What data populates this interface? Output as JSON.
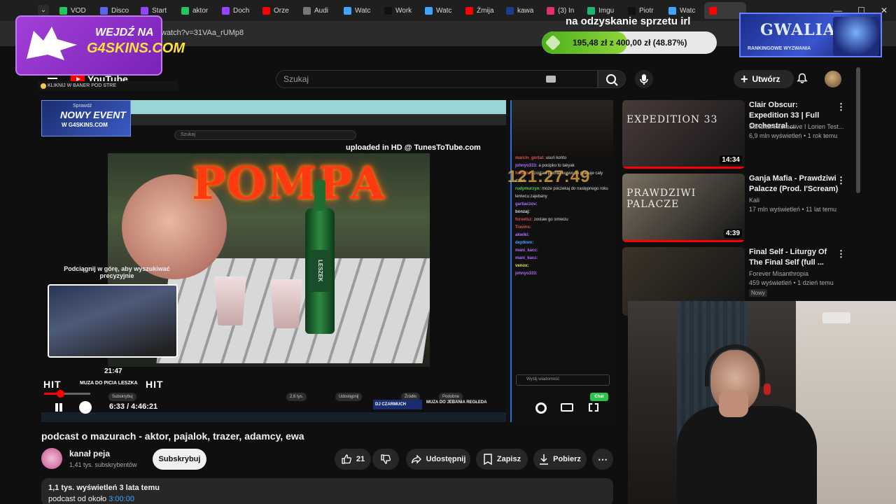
{
  "browser": {
    "tabs": [
      {
        "label": "VOD",
        "color": "#22c55e"
      },
      {
        "label": "Disco",
        "color": "#5865f2"
      },
      {
        "label": "Start",
        "color": "#9146ff"
      },
      {
        "label": "aktor",
        "color": "#22c55e"
      },
      {
        "label": "Doch",
        "color": "#9146ff"
      },
      {
        "label": "Orze",
        "color": "#ff0000"
      },
      {
        "label": "Audi",
        "color": "#777777"
      },
      {
        "label": "Watc",
        "color": "#3ea6ff"
      },
      {
        "label": "Work",
        "color": "#111111"
      },
      {
        "label": "Watc",
        "color": "#3ea6ff"
      },
      {
        "label": "Żmija",
        "color": "#ff0000"
      },
      {
        "label": "kawa",
        "color": "#1a3e8a"
      },
      {
        "label": "(3) In",
        "color": "#e1306c"
      },
      {
        "label": "Imgu",
        "color": "#1bb76e"
      },
      {
        "label": "Piotr",
        "color": "#111111"
      },
      {
        "label": "Watc",
        "color": "#3ea6ff"
      },
      {
        "label": "",
        "color": "#ff0000"
      }
    ],
    "url": "watch?v=31VAa_rUMp8"
  },
  "overlay": {
    "promo_line1": "WEJDŹ NA",
    "promo_line2": "G4SKINS.COM",
    "promo_strip": "KLIKNIJ W BANER POD STRE",
    "goal_title": "na odzyskanie sprzetu irl",
    "goal_text": "195,48 zł  z  400,00 zł  (48.87%)",
    "goal_fraction": 0.4887,
    "gwalia_title": "GWALIA",
    "gwalia_sub": "RANKINGOWE WYZWANIA"
  },
  "header": {
    "logo": "YouTube",
    "search_placeholder": "Szukaj",
    "create_label": "Utwórz"
  },
  "player": {
    "inner_banner_top": "Sprawdź",
    "inner_banner_title": "NOWY EVENT",
    "inner_banner_site": "W G4SKINS.COM",
    "inner_search": "Szukaj",
    "uploaded": "uploaded in HD @ TunesToTube.com",
    "video_text": "POMPA",
    "bottle_label": "LESZEK",
    "hint": "Podciągnij w górę, aby wyszukiwać precyzyjnie",
    "mini_time": "21:47",
    "hit_word": "HIT",
    "hit_title": "MUZA DO PICIA LESZKA",
    "inner_actions": [
      "Subskrybuj",
      "2,6 tys.",
      "Udostępnij",
      "Źródło",
      "Podobne"
    ],
    "inner_rec": "MUZA DO JEBANIA REGŁEDA",
    "inner_rec_channel": "DJ CZARMUCH",
    "timer": "121:27:49",
    "chat_messages": [
      {
        "user": "marcin_gortat:",
        "text": "usuń konto",
        "color": "#e05050"
      },
      {
        "user": "johnyo333:",
        "text": "a pocipko to takyak",
        "color": "#b070ff"
      },
      {
        "user": "forsetsz:",
        "text": "zostaw pietraa kurwo on pracuje cały dzień",
        "color": "#e05050"
      },
      {
        "user": "rudymurzyn:",
        "text": "może poczekaj do następnego roku leniwcu zajebany",
        "color": "#4fd04f"
      },
      {
        "user": "garbaczov:",
        "text": "",
        "color": "#b070ff"
      },
      {
        "user": "bonzaj:",
        "text": "",
        "color": "#d8d8d8"
      },
      {
        "user": "forsetsz:",
        "text": "zostaw go smieciu",
        "color": "#e05050"
      },
      {
        "user": "Travins:",
        "text": "",
        "color": "#e05050"
      },
      {
        "user": "akwiki:",
        "text": "",
        "color": "#b070ff"
      },
      {
        "user": "deptkwn:",
        "text": "",
        "color": "#3ea6ff"
      },
      {
        "user": "mani_kacc:",
        "text": "",
        "color": "#b070ff"
      },
      {
        "user": "mani_kacc:",
        "text": "",
        "color": "#b070ff"
      },
      {
        "user": "venox:",
        "text": "",
        "color": "#e8e84a"
      },
      {
        "user": "johnyo333:",
        "text": "",
        "color": "#b070ff"
      }
    ],
    "chat_placeholder": "Wyślij wiadomość",
    "chat_send": "Chat",
    "time": "6:33 / 4:46:21",
    "progress_fraction": 0.023
  },
  "video": {
    "title": "podcast o mazurach - aktor, pajalok, trazer, adamcy, ewa",
    "channel": "kanał peja",
    "subs": "1,41 tys. subskrybentów",
    "subscribe_label": "Subskrybuj",
    "likes": "21",
    "share_label": "Udostępnij",
    "save_label": "Zapisz",
    "download_label": "Pobierz",
    "views_line": "1,1 tys. wyświetleń  3 lata temu",
    "desc_text": "podcast od około",
    "desc_timestamp": "3:00:00"
  },
  "recommendations": [
    {
      "title": "Clair Obscur: Expedition 33 | Full Orchestral ...",
      "channel": "Sandfall Interactive I Lorien Test...",
      "meta": "6,9 mln wyświetleń • 1 rok temu",
      "duration": "14:34",
      "thumb_text": "EXPEDITION 33",
      "thumb_color": "#4a3a3a",
      "badge": ""
    },
    {
      "title": "Ganja Mafia - Prawdziwi Palacze (Prod. I'Scream)",
      "channel": "Kali",
      "meta": "17 mln wyświetleń • 11 lat temu",
      "duration": "4:39",
      "thumb_text": "PRAWDZIWI PALACZE",
      "thumb_color": "#7a7060",
      "badge": ""
    },
    {
      "title": "Final Self - Liturgy Of The Final Self (full ...",
      "channel": "Forever Misanthropia",
      "meta": "459 wyświetleń • 1 dzień temu",
      "duration": "",
      "thumb_text": "",
      "thumb_color": "#3a3328",
      "badge": "Nowy"
    }
  ]
}
